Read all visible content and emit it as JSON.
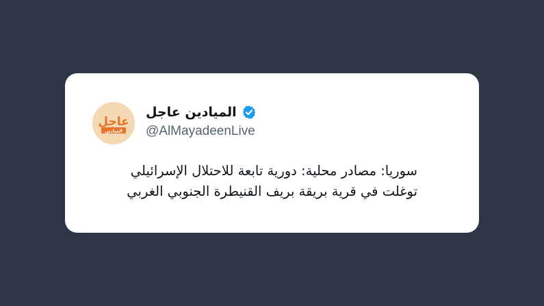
{
  "tweet": {
    "display_name": "الميادين عاجل",
    "handle": "@AlMayadeenLive",
    "verified": true,
    "avatar": {
      "icon": "almayadeen-breaking-logo",
      "logo_text_main": "عاجل",
      "logo_text_sub": "الميادين"
    },
    "text_lines": [
      "سوريا: مصادر محلية: دورية تابعة للاحتلال الإسرائيلي",
      "توغلت في قرية بريقة بريف القنيطرة الجنوبي الغربي"
    ]
  },
  "colors": {
    "background": "#2e3646",
    "card": "#ffffff",
    "verified_badge": "#1d9bf0",
    "handle": "#536471",
    "text": "#0f1419",
    "logo_accent": "#e8742a"
  }
}
